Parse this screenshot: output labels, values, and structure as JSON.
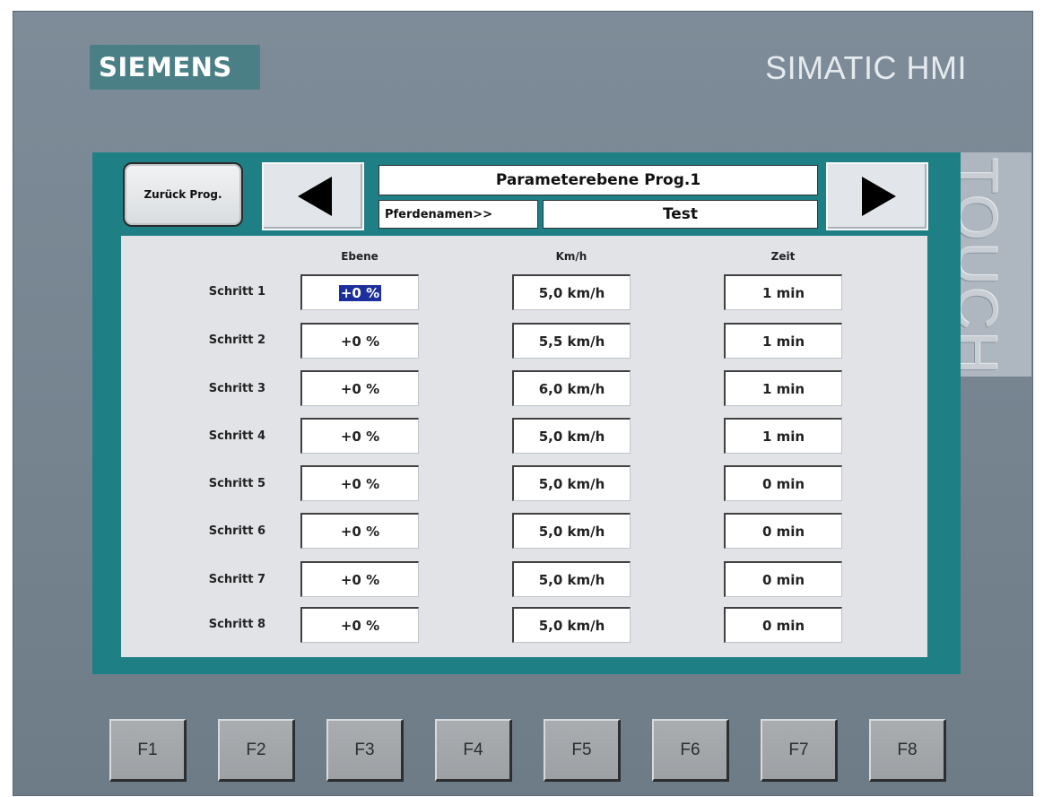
{
  "brand": {
    "logo": "SIEMENS",
    "model": "SIMATIC HMI",
    "touch": "TOUCH"
  },
  "toolbar": {
    "back_label": "Zurück Prog.",
    "prev_icon": "left-triangle-icon",
    "next_icon": "right-triangle-icon",
    "title": "Parameterebene Prog.1",
    "name_label": "Pferdenamen>>",
    "name_value": "Test"
  },
  "table": {
    "headers": [
      "Ebene",
      "Km/h",
      "Zeit"
    ],
    "rows": [
      {
        "label": "Schritt 1",
        "ebene": "+0 %",
        "speed": "5,0 km/h",
        "zeit": "1 min"
      },
      {
        "label": "Schritt 2",
        "ebene": "+0 %",
        "speed": "5,5 km/h",
        "zeit": "1 min"
      },
      {
        "label": "Schritt 3",
        "ebene": "+0 %",
        "speed": "6,0 km/h",
        "zeit": "1 min"
      },
      {
        "label": "Schritt 4",
        "ebene": "+0 %",
        "speed": "5,0 km/h",
        "zeit": "1 min"
      },
      {
        "label": "Schritt 5",
        "ebene": "+0 %",
        "speed": "5,0 km/h",
        "zeit": "0 min"
      },
      {
        "label": "Schritt 6",
        "ebene": "+0 %",
        "speed": "5,0 km/h",
        "zeit": "0 min"
      },
      {
        "label": "Schritt 7",
        "ebene": "+0 %",
        "speed": "5,0 km/h",
        "zeit": "0 min"
      },
      {
        "label": "Schritt 8",
        "ebene": "+0 %",
        "speed": "5,0 km/h",
        "zeit": "0 min"
      }
    ]
  },
  "function_keys": [
    "F1",
    "F2",
    "F3",
    "F4",
    "F5",
    "F6",
    "F7",
    "F8"
  ],
  "colors": {
    "frame": "#1e7f85",
    "bezel": "#7e8c99",
    "brand_box": "#4a7f86",
    "selection": "#1c2f9c"
  }
}
